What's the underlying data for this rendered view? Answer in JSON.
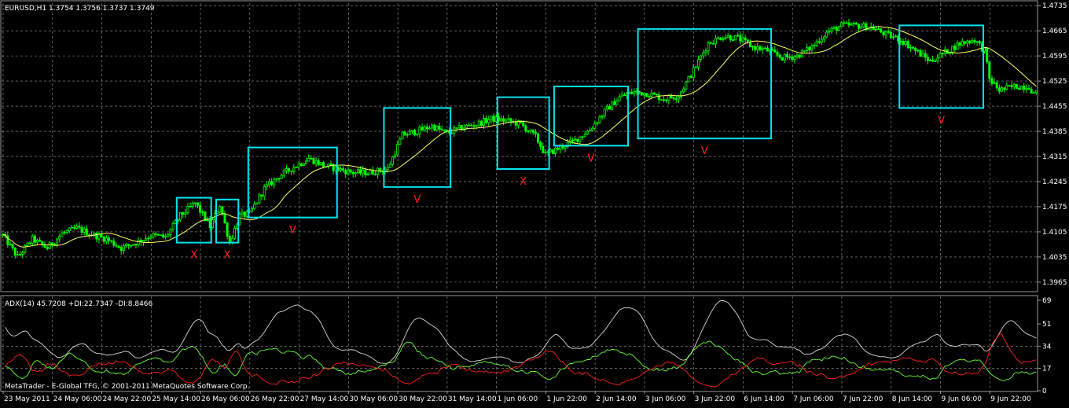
{
  "header": {
    "symbol_info": "EURUSD,H1  1.3754 1.3756 1.3737 1.3749"
  },
  "indicator": {
    "label": "ADX(14) 45.7208 +DI:22.7347 -DI:8.8466",
    "scale_labels": [
      "69",
      "51",
      "34",
      "17",
      "0"
    ]
  },
  "copyright": "MetaTrader - E-Global TFG, © 2001-2011 MetaQuotes Software Corp.",
  "colors": {
    "background": "#000000",
    "grid": "#9a9a9a",
    "candles": "#00ff00",
    "moving_average": "#ffff66",
    "boxes": "#00e5ee",
    "marks": "#ff2020",
    "adx": "#d8d8d8",
    "plus_di": "#66ff33",
    "minus_di": "#ff2020"
  },
  "chart_data": [
    {
      "type": "line",
      "subtype": "candlestick",
      "symbol": "EURUSD",
      "timeframe": "H1",
      "x_tick_labels": [
        "23 May 2011",
        "24 May 06:00",
        "24 May 22:00",
        "25 May 14:00",
        "26 May 06:00",
        "26 May 22:00",
        "27 May 14:00",
        "30 May 06:00",
        "30 May 22:00",
        "31 May 14:00",
        "1 Jun 06:00",
        "1 Jun 22:00",
        "2 Jun 14:00",
        "3 Jun 06:00",
        "3 Jun 22:00",
        "6 Jun 14:00",
        "7 Jun 06:00",
        "7 Jun 22:00",
        "8 Jun 14:00",
        "9 Jun 06:00",
        "9 Jun 22:00"
      ],
      "y_tick_labels": [
        "1.4735",
        "1.4665",
        "1.4595",
        "1.4525",
        "1.4455",
        "1.4385",
        "1.4315",
        "1.4245",
        "1.4175",
        "1.4105",
        "1.4035",
        "1.3965"
      ],
      "ylim": [
        1.3945,
        1.4742
      ],
      "price_key_points": [
        [
          0,
          1.4095
        ],
        [
          6,
          1.4035
        ],
        [
          12,
          1.4085
        ],
        [
          18,
          1.406
        ],
        [
          24,
          1.41
        ],
        [
          30,
          1.4115
        ],
        [
          36,
          1.4098
        ],
        [
          42,
          1.4085
        ],
        [
          48,
          1.406
        ],
        [
          54,
          1.4075
        ],
        [
          60,
          1.4095
        ],
        [
          66,
          1.409
        ],
        [
          72,
          1.415
        ],
        [
          78,
          1.4185
        ],
        [
          84,
          1.412
        ],
        [
          88,
          1.418
        ],
        [
          92,
          1.4075
        ],
        [
          96,
          1.415
        ],
        [
          100,
          1.4155
        ],
        [
          106,
          1.4225
        ],
        [
          112,
          1.426
        ],
        [
          118,
          1.4285
        ],
        [
          124,
          1.431
        ],
        [
          130,
          1.429
        ],
        [
          136,
          1.428
        ],
        [
          142,
          1.427
        ],
        [
          148,
          1.427
        ],
        [
          156,
          1.428
        ],
        [
          162,
          1.4375
        ],
        [
          168,
          1.4385
        ],
        [
          174,
          1.44
        ],
        [
          180,
          1.438
        ],
        [
          186,
          1.4395
        ],
        [
          192,
          1.4405
        ],
        [
          198,
          1.442
        ],
        [
          204,
          1.4415
        ],
        [
          210,
          1.4405
        ],
        [
          216,
          1.437
        ],
        [
          220,
          1.432
        ],
        [
          226,
          1.434
        ],
        [
          232,
          1.436
        ],
        [
          238,
          1.439
        ],
        [
          244,
          1.444
        ],
        [
          250,
          1.448
        ],
        [
          256,
          1.4495
        ],
        [
          262,
          1.449
        ],
        [
          268,
          1.4475
        ],
        [
          274,
          1.4485
        ],
        [
          280,
          1.4555
        ],
        [
          286,
          1.463
        ],
        [
          292,
          1.465
        ],
        [
          298,
          1.4645
        ],
        [
          304,
          1.462
        ],
        [
          310,
          1.461
        ],
        [
          316,
          1.459
        ],
        [
          322,
          1.4595
        ],
        [
          328,
          1.462
        ],
        [
          334,
          1.466
        ],
        [
          340,
          1.468
        ],
        [
          346,
          1.468
        ],
        [
          352,
          1.4675
        ],
        [
          358,
          1.4655
        ],
        [
          364,
          1.464
        ],
        [
          370,
          1.461
        ],
        [
          376,
          1.458
        ],
        [
          382,
          1.4605
        ],
        [
          388,
          1.463
        ],
        [
          394,
          1.464
        ],
        [
          398,
          1.461
        ],
        [
          400,
          1.453
        ],
        [
          404,
          1.45
        ],
        [
          410,
          1.451
        ],
        [
          416,
          1.451
        ],
        [
          418,
          1.449
        ]
      ],
      "pattern_boxes": [
        {
          "from_bar": 71,
          "to_bar": 84,
          "top": 1.42,
          "bottom": 1.4075,
          "mark": "X"
        },
        {
          "from_bar": 87,
          "to_bar": 95,
          "top": 1.4195,
          "bottom": 1.4075,
          "mark": "X"
        },
        {
          "from_bar": 100,
          "to_bar": 135,
          "top": 1.434,
          "bottom": 1.4145,
          "mark": "V"
        },
        {
          "from_bar": 155,
          "to_bar": 181,
          "top": 1.445,
          "bottom": 1.423,
          "mark": "V"
        },
        {
          "from_bar": 201,
          "to_bar": 221,
          "top": 1.448,
          "bottom": 1.428,
          "mark": "X"
        },
        {
          "from_bar": 224,
          "to_bar": 253,
          "top": 1.451,
          "bottom": 1.4345,
          "mark": "V"
        },
        {
          "from_bar": 258,
          "to_bar": 311,
          "top": 1.467,
          "bottom": 1.4365,
          "mark": "V"
        },
        {
          "from_bar": 364,
          "to_bar": 397,
          "top": 1.468,
          "bottom": 1.445,
          "mark": "V"
        }
      ]
    },
    {
      "type": "line",
      "subtype": "ADX indicator",
      "ylim": [
        0,
        72
      ],
      "y_tick_labels": [
        "69",
        "51",
        "34",
        "17",
        "0"
      ],
      "series": [
        {
          "name": "ADX(14)",
          "last": 45.7208
        },
        {
          "name": "+DI",
          "last": 22.7347
        },
        {
          "name": "-DI",
          "last": 8.8466
        }
      ]
    }
  ]
}
